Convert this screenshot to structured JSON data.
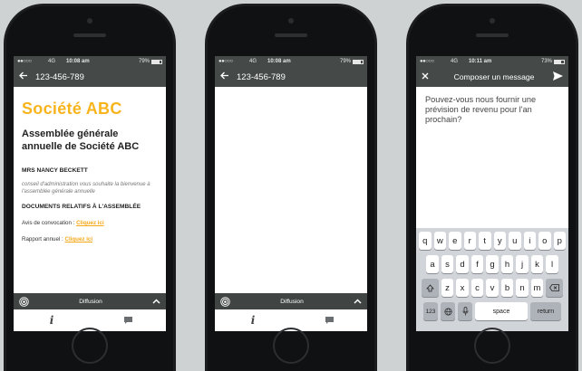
{
  "status": {
    "signal": "●●○○○",
    "network": "4G",
    "time": "10:08 am",
    "battery": "79%"
  },
  "status3": {
    "signal": "●●○○○",
    "network": "4G",
    "time": "10:11 am",
    "battery": "73%"
  },
  "phone1": {
    "header_number": "123-456-789",
    "company": "Société ABC",
    "assembly": "Assemblée générale annuelle de Société ABC",
    "person": "MRS NANCY BECKETT",
    "description": "conseil d'administration vous souhaite la bienvenue à l'assemblée générale annuelle",
    "docs_title": "DOCUMENTS RELATIFS À L'ASSEMBLÉE",
    "doc1_label": "Avis de convocation : ",
    "doc1_link": "Cliquez ici",
    "doc2_label": "Rapport annuel : ",
    "doc2_link": "Cliquez ici",
    "broadcast_label": "Diffusion"
  },
  "phone2": {
    "header_number": "123-456-789",
    "broadcast_label": "Diffusion"
  },
  "phone3": {
    "title": "Composer un message",
    "message": "Pouvez-vous nous fournir une prévision de revenu pour l'an prochain?",
    "keyboard": {
      "row1": [
        "q",
        "w",
        "e",
        "r",
        "t",
        "y",
        "u",
        "i",
        "o",
        "p"
      ],
      "row2": [
        "a",
        "s",
        "d",
        "f",
        "g",
        "h",
        "j",
        "k",
        "l"
      ],
      "row3": [
        "z",
        "x",
        "c",
        "v",
        "b",
        "n",
        "m"
      ],
      "numbers_key": "123",
      "space_key": "space",
      "return_key": "return"
    }
  },
  "icons": {
    "back": "arrow-left-icon",
    "broadcast": "broadcast-icon",
    "chevron": "chevron-up-icon",
    "info": "info-icon",
    "chat": "chat-icon",
    "send": "send-icon"
  },
  "colors": {
    "accent": "#f7b41d",
    "bar": "#454a49"
  }
}
